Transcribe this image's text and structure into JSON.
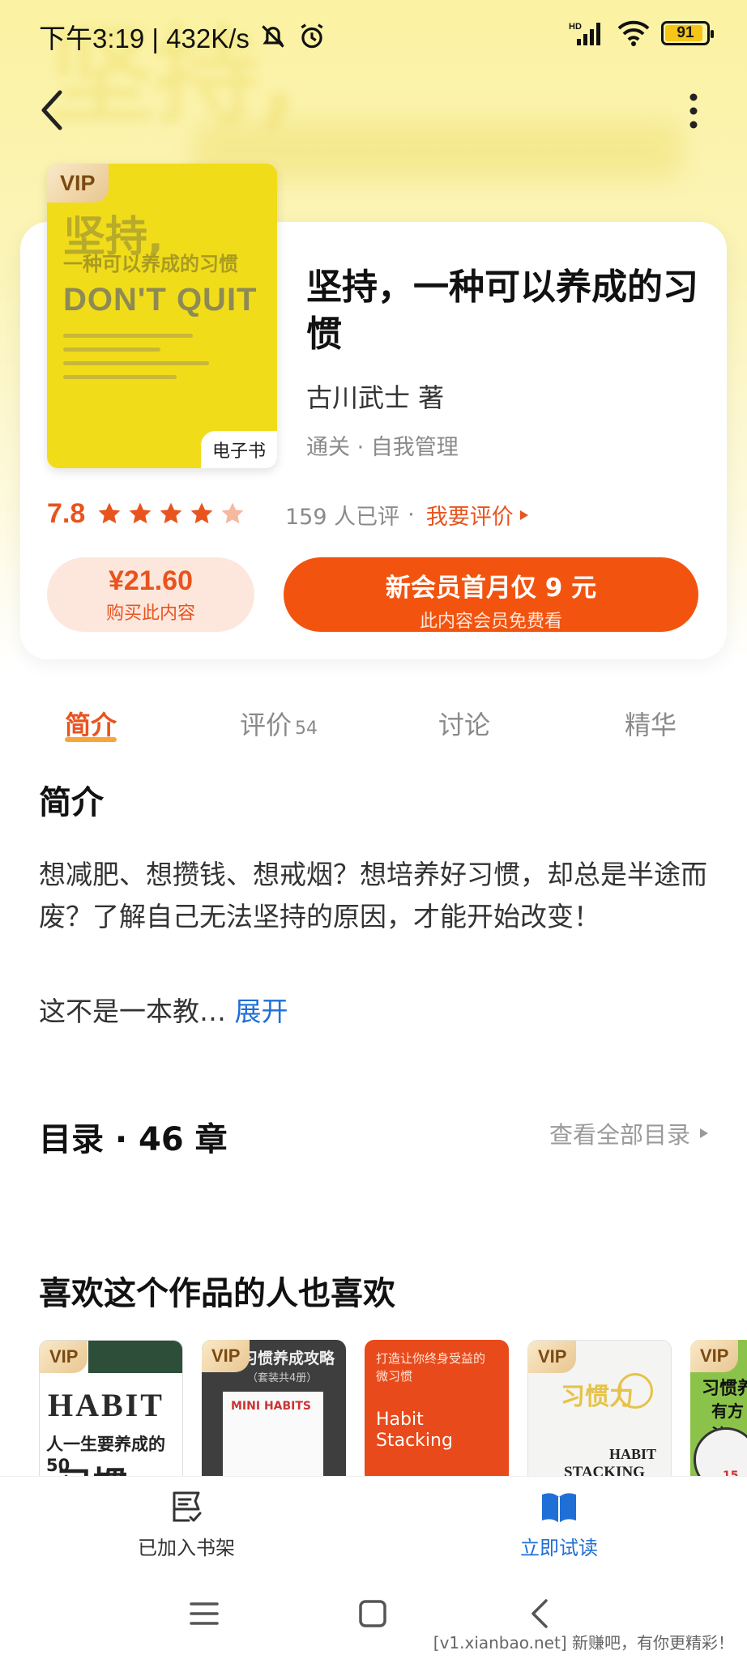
{
  "status_bar": {
    "time_speed": "下午3:19 | 432K/s",
    "network": "HD",
    "battery": "91"
  },
  "book": {
    "cover_title": "坚持,",
    "cover_subtitle": "一种可以养成的习惯",
    "cover_english": "DON'T QUIT",
    "vip_badge": "VIP",
    "format_tag": "电子书",
    "title": "坚持，一种可以养成的习惯",
    "author": "古川武士 著",
    "tags": "通关 · 自我管理"
  },
  "rating": {
    "score": "7.8",
    "stars": 4.5,
    "count_text": "159 人已评",
    "separator": "·",
    "rate_link": "我要评价"
  },
  "purchase": {
    "price": "¥21.60",
    "price_sub": "购买此内容",
    "vip_main": "新会员首月仅 9 元",
    "vip_sub": "此内容会员免费看"
  },
  "tabs": [
    {
      "label": "简介",
      "count": ""
    },
    {
      "label": "评价",
      "count": "54"
    },
    {
      "label": "讨论",
      "count": ""
    },
    {
      "label": "精华",
      "count": ""
    }
  ],
  "intro": {
    "heading": "简介",
    "text": "想减肥、想攒钱、想戒烟？想培养好习惯，却总是半途而废？了解自己无法坚持的原因，才能开始改变！",
    "teaser": "这不是一本教…",
    "expand": "展开"
  },
  "toc": {
    "heading": "目录 · 46 章",
    "link": "查看全部目录"
  },
  "recommend": {
    "heading": "喜欢这个作品的人也喜欢",
    "items": [
      {
        "vip": "VIP",
        "line1": "HABIT",
        "line2": "人一生要养成的50",
        "line3": "习惯"
      },
      {
        "vip": "VIP",
        "line1": "习惯养成攻略",
        "line2": "（套装共4册）",
        "line3": "MINI HABITS"
      },
      {
        "vip": "",
        "line1": "打造让你终身受益的",
        "line2": "微习惯",
        "line3": "Habit Stacking"
      },
      {
        "vip": "VIP",
        "line1": "习惯力",
        "line2": "HABIT",
        "line3": "STACKING"
      },
      {
        "vip": "VIP",
        "line1": "习惯养",
        "line2": "有方法",
        "line3": "15"
      }
    ]
  },
  "bottom_bar": {
    "shelf_label": "已加入书架",
    "read_label": "立即试读"
  },
  "watermark": "[v1.xianbao.net] 新赚吧，有你更精彩！",
  "colors": {
    "accent": "#e8541e",
    "vip_button": "#f25410",
    "link_blue": "#1f6fd6",
    "cover_yellow": "#f1dc1a"
  }
}
